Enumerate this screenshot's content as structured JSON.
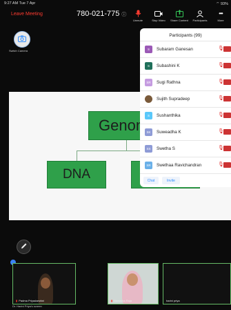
{
  "status": {
    "time": "9:27 AM  Tue 7 Apr",
    "system": "⌔ 93%"
  },
  "meeting": {
    "leave_label": "Leave Meeting",
    "id": "780-021-775",
    "info_icon": "ⓘ"
  },
  "toolbar": [
    {
      "label": "Unmute",
      "icon": "mic-off-icon",
      "glyph": "🎙",
      "color": "#ff3b30"
    },
    {
      "label": "Stop Video",
      "icon": "video-icon",
      "glyph": "▭",
      "color": "#ffffff"
    },
    {
      "label": "Share Content",
      "icon": "share-icon",
      "glyph": "⇧",
      "color": "#35c759"
    },
    {
      "label": "Participants",
      "icon": "participants-icon",
      "glyph": "👤",
      "color": "#ffffff"
    },
    {
      "label": "More",
      "icon": "more-icon",
      "glyph": "•••",
      "color": "#ffffff"
    }
  ],
  "switch_camera": {
    "label": "Switch Camera"
  },
  "slide": {
    "genome": "Genom",
    "dna": "DNA"
  },
  "participants_panel": {
    "title": "Participants (99)",
    "items": [
      {
        "name": "Subaram Ganesan",
        "initials": "S",
        "color": "#9b59b6"
      },
      {
        "name": "Subashini K",
        "initials": "S",
        "color": "#1f6f5a"
      },
      {
        "name": "Sugi Rathna",
        "initials": "SR",
        "color": "#c59be0"
      },
      {
        "name": "Sujith Supradeep",
        "initials": "",
        "color": "#7a5a3a"
      },
      {
        "name": "Sushanthika",
        "initials": "S",
        "color": "#5ac8fa"
      },
      {
        "name": "Suweadha K",
        "initials": "SK",
        "color": "#8e9bd6"
      },
      {
        "name": "Swetha S",
        "initials": "SS",
        "color": "#8e9bd6"
      },
      {
        "name": "Swethaa Ravichandran",
        "initials": "SR",
        "color": "#6ab0e8"
      }
    ],
    "chat_label": "Chat",
    "invite_label": "Invite"
  },
  "gallery": {
    "tiles": [
      {
        "name": "Padma Priyadarshini"
      },
      {
        "name": "Manasha Raja"
      },
      {
        "name": "harini priya"
      }
    ],
    "host_label": "Dr. Harini Priya's screen"
  },
  "colors": {
    "accent": "#2d8cff",
    "alert": "#ff3b30",
    "slide_box": "#2fa04a"
  }
}
